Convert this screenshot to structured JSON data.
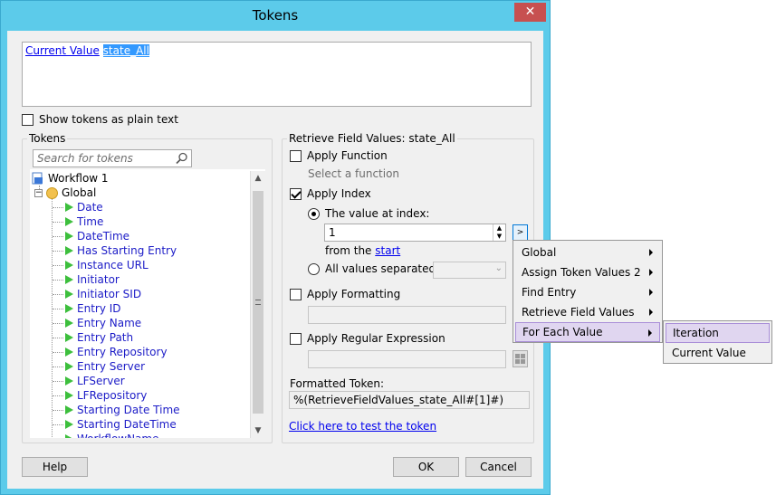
{
  "window": {
    "title": "Tokens",
    "close_glyph": "✕"
  },
  "token_text": {
    "part1": "Current Value",
    "part2": "state_All"
  },
  "show_plain": {
    "label": "Show tokens as plain text",
    "checked": false
  },
  "tokens_group": {
    "label": "Tokens",
    "search_placeholder": "Search for tokens",
    "tree": {
      "root": "Workflow 1",
      "group": "Global",
      "items": [
        "Date",
        "Time",
        "DateTime",
        "Has Starting Entry",
        "Instance URL",
        "Initiator",
        "Initiator SID",
        "Entry ID",
        "Entry Name",
        "Entry Path",
        "Entry Repository",
        "Entry Server",
        "LFServer",
        "LFRepository",
        "Starting Date Time",
        "Starting DateTime",
        "WorkflowName"
      ]
    }
  },
  "right": {
    "title": "Retrieve Field Values: state_All",
    "apply_function": {
      "label": "Apply Function",
      "checked": false,
      "hint": "Select a function"
    },
    "apply_index": {
      "label": "Apply Index",
      "checked": true
    },
    "value_at_index": {
      "label": "The value at index:",
      "value": "1",
      "from_label": "from the",
      "from_link": "start"
    },
    "all_values": {
      "label": "All values separated by:"
    },
    "apply_formatting": {
      "label": "Apply Formatting",
      "checked": false
    },
    "apply_regex": {
      "label": "Apply Regular Expression",
      "checked": false
    },
    "formatted_label": "Formatted Token:",
    "formatted_value": "%(RetrieveFieldValues_state_All#[1]#)",
    "test_link": "Click here to test the token",
    "picker_glyph": ">"
  },
  "buttons": {
    "help": "Help",
    "ok": "OK",
    "cancel": "Cancel"
  },
  "menu": {
    "items": [
      "Global",
      "Assign Token Values 2",
      "Find Entry",
      "Retrieve Field Values",
      "For Each Value"
    ],
    "active_index": 4
  },
  "submenu": {
    "items": [
      "Iteration",
      "Current Value"
    ],
    "active_index": 0
  }
}
